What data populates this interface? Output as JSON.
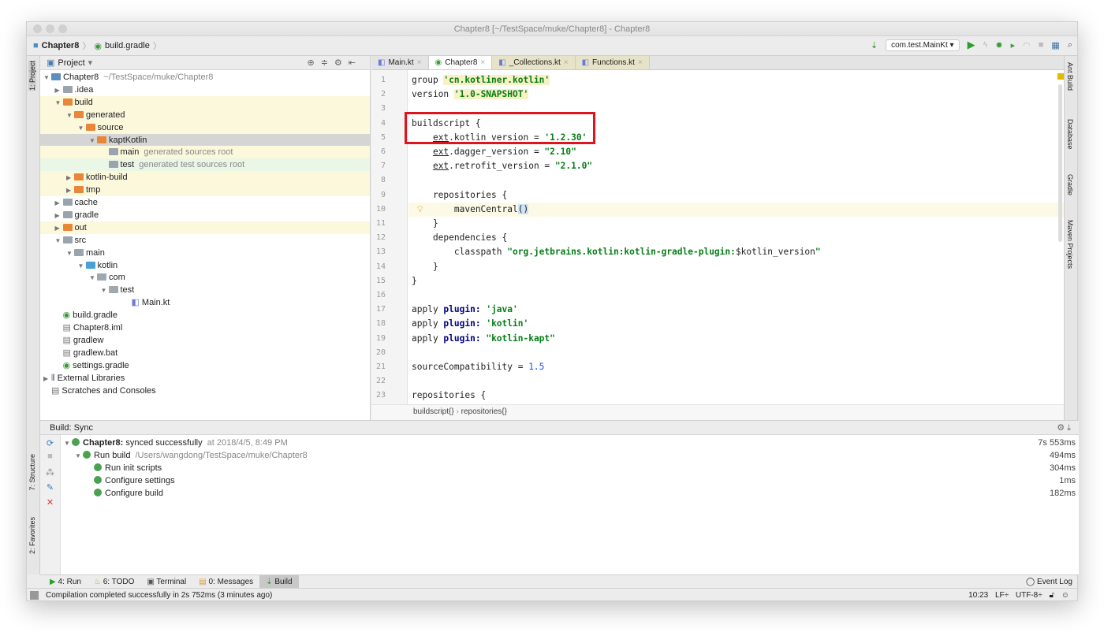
{
  "window": {
    "title": "Chapter8 [~/TestSpace/muke/Chapter8] - Chapter8"
  },
  "breadcrumb": [
    "Chapter8",
    "build.gradle"
  ],
  "toolbar": {
    "run_config": "com.test.MainKt"
  },
  "left_strip": {
    "project": "1: Project",
    "structure": "7: Structure",
    "favorites": "2: Favorites"
  },
  "right_strip": [
    "Ant Build",
    "Database",
    "Gradle",
    "Maven Projects"
  ],
  "project": {
    "title": "Project",
    "tree": [
      {
        "label": "Chapter8",
        "hint": "~/TestSpace/muke/Chapter8",
        "depth": 0,
        "open": true,
        "type": "module"
      },
      {
        "label": ".idea",
        "depth": 1,
        "open": false,
        "type": "folder"
      },
      {
        "label": "build",
        "depth": 1,
        "open": true,
        "type": "excluded",
        "hl": "y"
      },
      {
        "label": "generated",
        "depth": 2,
        "open": true,
        "type": "excluded",
        "hl": "y"
      },
      {
        "label": "source",
        "depth": 3,
        "open": true,
        "type": "excluded",
        "hl": "y"
      },
      {
        "label": "kaptKotlin",
        "depth": 4,
        "open": true,
        "type": "excluded",
        "hl": "sel"
      },
      {
        "label": "main",
        "hint": "generated sources root",
        "depth": 5,
        "type": "gensrc",
        "hl": "y"
      },
      {
        "label": "test",
        "hint": "generated test sources root",
        "depth": 5,
        "type": "gentest",
        "hl": "g"
      },
      {
        "label": "kotlin-build",
        "depth": 2,
        "open": false,
        "type": "excluded",
        "hl": "y"
      },
      {
        "label": "tmp",
        "depth": 2,
        "open": false,
        "type": "excluded",
        "hl": "y"
      },
      {
        "label": "cache",
        "depth": 1,
        "open": false,
        "type": "folder"
      },
      {
        "label": "gradle",
        "depth": 1,
        "open": false,
        "type": "folder"
      },
      {
        "label": "out",
        "depth": 1,
        "open": false,
        "type": "excluded",
        "hl": "y"
      },
      {
        "label": "src",
        "depth": 1,
        "open": true,
        "type": "folder"
      },
      {
        "label": "main",
        "depth": 2,
        "open": true,
        "type": "folder"
      },
      {
        "label": "kotlin",
        "depth": 3,
        "open": true,
        "type": "src"
      },
      {
        "label": "com",
        "depth": 4,
        "open": true,
        "type": "pkg"
      },
      {
        "label": "test",
        "depth": 5,
        "open": true,
        "type": "pkg"
      },
      {
        "label": "Main.kt",
        "depth": 7,
        "type": "kt"
      },
      {
        "label": "build.gradle",
        "depth": 1,
        "type": "gradle"
      },
      {
        "label": "Chapter8.iml",
        "depth": 1,
        "type": "file"
      },
      {
        "label": "gradlew",
        "depth": 1,
        "type": "file"
      },
      {
        "label": "gradlew.bat",
        "depth": 1,
        "type": "file"
      },
      {
        "label": "settings.gradle",
        "depth": 1,
        "type": "gradle"
      },
      {
        "label": "External Libraries",
        "depth": 0,
        "open": false,
        "type": "lib"
      },
      {
        "label": "Scratches and Consoles",
        "depth": 0,
        "type": "scratch"
      }
    ]
  },
  "editor": {
    "tabs": [
      {
        "label": "Main.kt"
      },
      {
        "label": "Chapter8",
        "active": true
      },
      {
        "label": "_Collections.kt"
      },
      {
        "label": "Functions.kt"
      }
    ],
    "lines": [
      "group <s>'cn.kotliner.kotlin'</s>",
      "version <s>'1.0-SNAPSHOT'</s>",
      "",
      "buildscript {",
      "    <u>ext</u>.kotlin_version = <g>'1.2.30'</g>",
      "    <u>ext</u>.dagger_version = <g>\"2.10\"</g>",
      "    <u>ext</u>.retrofit_version = <g>\"2.1.0\"</g>",
      "",
      "    repositories {",
      "        mavenCentral()",
      "    }",
      "    dependencies {",
      "        classpath <g>\"org.jetbrains.kotlin:kotlin-gradle-plugin:</g>$kotlin_version<g>\"</g>",
      "    }",
      "}",
      "",
      "apply <k>plugin:</k> <g>'java'</g>",
      "apply <k>plugin:</k> <g>'kotlin'</g>",
      "apply <k>plugin:</k> <g>\"kotlin-kapt\"</g>",
      "",
      "sourceCompatibility = <n>1.5</n>",
      "",
      "repositories {"
    ],
    "breadcrumb": [
      "buildscript{}",
      "repositories{}"
    ]
  },
  "build": {
    "title": "Build: Sync",
    "rows": [
      {
        "bold": "Chapter8:",
        "text": " synced successfully",
        "hint": "at 2018/4/5, 8:49 PM",
        "duration": "7s 553ms",
        "depth": 0
      },
      {
        "text": "Run build",
        "hint": "/Users/wangdong/TestSpace/muke/Chapter8",
        "duration": "494ms",
        "depth": 1
      },
      {
        "text": "Run init scripts",
        "duration": "304ms",
        "depth": 2
      },
      {
        "text": "Configure settings",
        "duration": "1ms",
        "depth": 2
      },
      {
        "text": "Configure build",
        "duration": "182ms",
        "depth": 2
      }
    ]
  },
  "bottom_tabs": [
    {
      "label": "4: Run"
    },
    {
      "label": "6: TODO"
    },
    {
      "label": "Terminal"
    },
    {
      "label": "0: Messages"
    },
    {
      "label": "Build",
      "active": true
    }
  ],
  "event_log": "Event Log",
  "status": {
    "message": "Compilation completed successfully in 2s 752ms (3 minutes ago)",
    "position": "10:23",
    "line_sep": "LF÷",
    "encoding": "UTF-8÷"
  }
}
